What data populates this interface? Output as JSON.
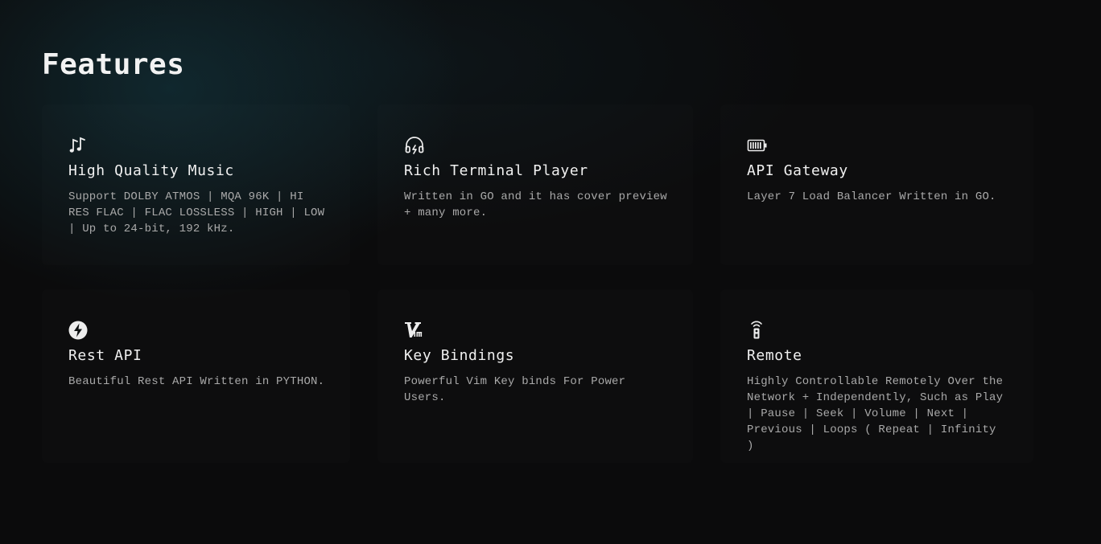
{
  "page": {
    "title": "Features"
  },
  "features": [
    {
      "icon": "music-notes-icon",
      "title": "High Quality Music",
      "description": "Support DOLBY ATMOS | MQA 96K | HI RES FLAC | FLAC LOSSLESS | HIGH | LOW | Up to 24-bit, 192 kHz."
    },
    {
      "icon": "headphones-icon",
      "title": "Rich Terminal Player",
      "description": "Written in GO and it has cover preview + many more."
    },
    {
      "icon": "battery-full-icon",
      "title": "API Gateway",
      "description": "Layer 7 Load Balancer Written in GO."
    },
    {
      "icon": "lightning-bolt-icon",
      "title": "Rest API",
      "description": "Beautiful Rest API Written in PYTHON."
    },
    {
      "icon": "vim-logo-icon",
      "title": "Key Bindings",
      "description": "Powerful Vim Key binds For Power Users."
    },
    {
      "icon": "remote-control-icon",
      "title": "Remote",
      "description": "Highly Controllable Remotely Over the Network + Independently, Such as Play | Pause | Seek | Volume | Next | Previous | Loops ( Repeat | Infinity )"
    }
  ]
}
